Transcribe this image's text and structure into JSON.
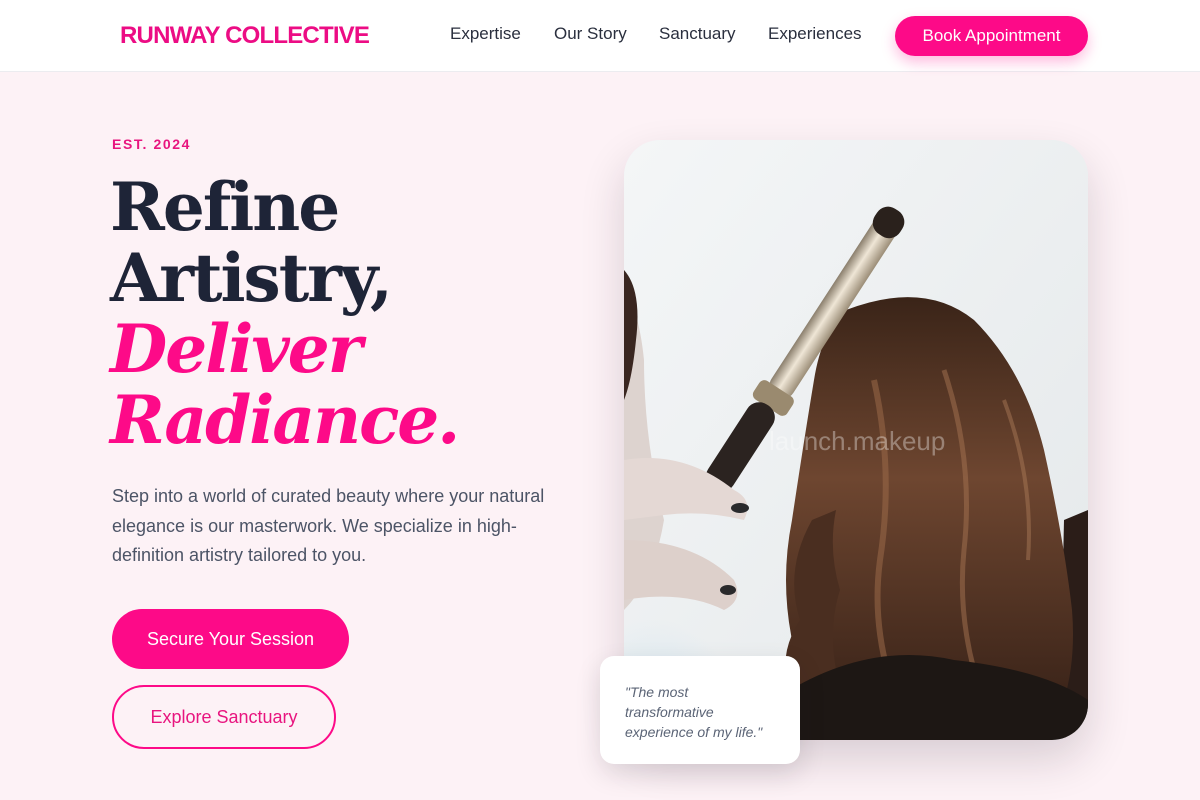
{
  "brand": {
    "logo": "RUNWAY COLLECTIVE",
    "accent_color": "#fd0a88"
  },
  "nav": {
    "items": [
      {
        "label": "Expertise"
      },
      {
        "label": "Our Story"
      },
      {
        "label": "Sanctuary"
      },
      {
        "label": "Experiences"
      }
    ],
    "cta": "Book Appointment"
  },
  "hero": {
    "eyebrow": "EST. 2024",
    "headline": {
      "line1": "Refine",
      "line2": "Artistry,",
      "line3": "Deliver",
      "line4": "Radiance."
    },
    "description": "Step into a world of curated beauty where your natural elegance is our masterwork. We specialize in high-definition artistry tailored to you.",
    "primary_cta": "Secure Your Session",
    "secondary_cta": "Explore Sanctuary",
    "image": {
      "subject": "stylist curling long brown hair with a curling iron",
      "watermark": "launch.makeup"
    },
    "testimonial": "\"The most transformative experience of my life.\""
  }
}
